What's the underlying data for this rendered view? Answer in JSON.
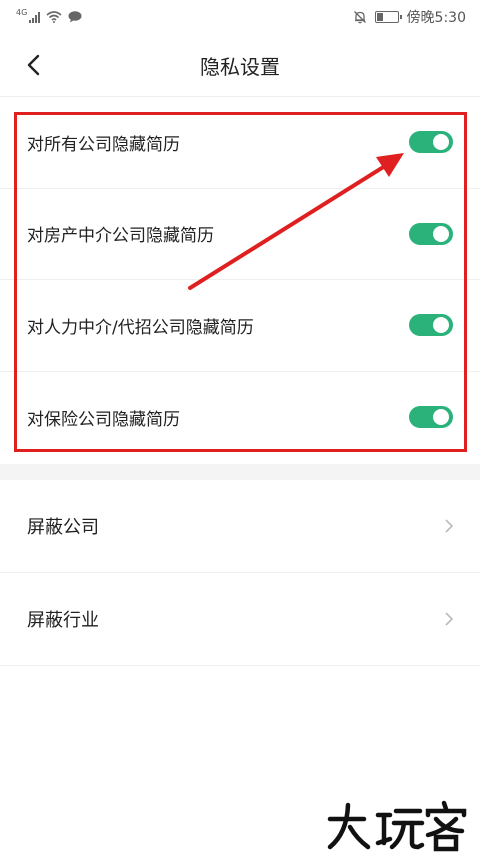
{
  "status_bar": {
    "network": "4G",
    "time": "傍晚5:30"
  },
  "header": {
    "title": "隐私设置"
  },
  "privacy_toggles": [
    {
      "label": "对所有公司隐藏简历",
      "enabled": true
    },
    {
      "label": "对房产中介公司隐藏简历",
      "enabled": true
    },
    {
      "label": "对人力中介/代招公司隐藏简历",
      "enabled": true
    },
    {
      "label": "对保险公司隐藏简历",
      "enabled": true
    }
  ],
  "nav_items": [
    {
      "label": "屏蔽公司"
    },
    {
      "label": "屏蔽行业"
    }
  ],
  "colors": {
    "toggle_on": "#2bb27b",
    "annotation": "#e02020"
  },
  "icons": [
    "back-arrow-icon",
    "chevron-right-icon",
    "bell-off-icon",
    "battery-icon",
    "wifi-icon",
    "signal-icon",
    "message-icon"
  ]
}
